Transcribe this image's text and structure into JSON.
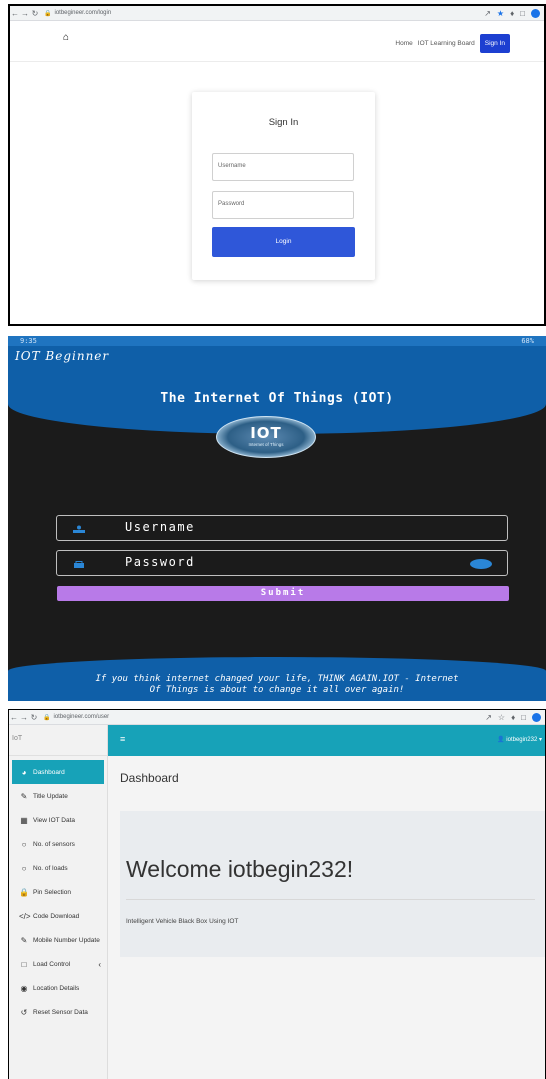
{
  "panel1": {
    "url": "iotbegineer.com/login",
    "nav": {
      "home": "Home",
      "board": "IOT Learning Board",
      "signin": "Sign In"
    },
    "card": {
      "title": "Sign In",
      "username_placeholder": "Username",
      "password_placeholder": "Password",
      "login_label": "Login"
    }
  },
  "panel2": {
    "status_time": "9:35",
    "status_right": "68%",
    "brand": "IOT Beginner",
    "title": "The Internet Of Things (IOT)",
    "logo_text": "IOT",
    "logo_subtext": "Internet of Things",
    "username_label": "Username",
    "password_label": "Password",
    "submit_label": "Submit",
    "footer_line1": "If you think internet changed your life, THINK AGAIN.IOT - Internet",
    "footer_line2": "Of Things is about to change it all over again!"
  },
  "panel3": {
    "url": "iotbegineer.com/user",
    "brand": "IoT",
    "user": "iotbegin232",
    "sidebar": [
      {
        "label": "Dashboard",
        "icon": "dashboard-icon",
        "active": true
      },
      {
        "label": "Title Update",
        "icon": "edit-icon"
      },
      {
        "label": "View IOT Data",
        "icon": "table-icon"
      },
      {
        "label": "No. of sensors",
        "icon": "circle-icon"
      },
      {
        "label": "No. of loads",
        "icon": "circle-icon"
      },
      {
        "label": "Pin Selection",
        "icon": "lock-icon"
      },
      {
        "label": "Code Download",
        "icon": "code-icon"
      },
      {
        "label": "Mobile Number Update",
        "icon": "edit-icon"
      },
      {
        "label": "Load Control",
        "icon": "square-icon"
      },
      {
        "label": "Location Details",
        "icon": "map-pin-icon"
      },
      {
        "label": "Reset Sensor Data",
        "icon": "reset-icon"
      }
    ],
    "page_title": "Dashboard",
    "welcome": "Welcome iotbegin232!",
    "subtitle": "Intelligent Vehicle Black Box Using IOT"
  },
  "colors": {
    "signin_blue": "#1d3fd1",
    "login_blue": "#2f57d9",
    "app_blue": "#0f5fa8",
    "submit_purple": "#b87ae8",
    "teal": "#17a2b8"
  }
}
